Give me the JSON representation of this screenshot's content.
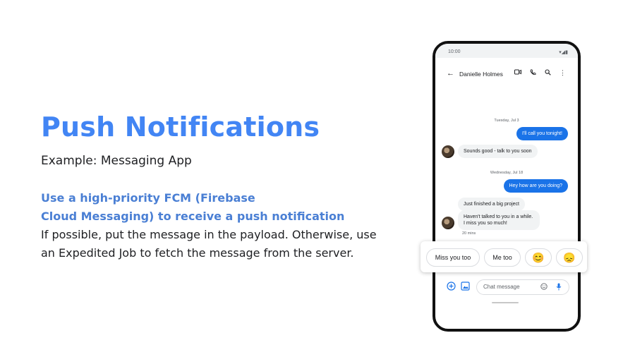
{
  "slide": {
    "title": "Push Notifications",
    "subtitle": "Example: Messaging App",
    "highlight_line_1": "Use a high-priority FCM (Firebase",
    "highlight_line_2": "Cloud Messaging) to receive a push notification",
    "body_line_1": "If possible, put the message in the payload. Otherwise, use",
    "body_line_2": "an Expedited Job to fetch the message from the server."
  },
  "phone": {
    "status_time": "10:00",
    "contact_name": "Danielle Holmes",
    "messages": {
      "date_1": "Tuesday, Jul 3",
      "sent_1": "I'll call you tonight!",
      "received_1": "Sounds good - talk to you soon",
      "date_2": "Wednesday, Jul 18",
      "sent_2": "Hey how are you doing?",
      "received_2": "Just finished a big project",
      "received_3_line_1": "Haven't talked to you in a while.",
      "received_3_line_2": "I miss you so much!",
      "timestamp": "20 mins"
    },
    "suggestions": {
      "chip_1": "Miss you too",
      "chip_2": "Me too",
      "chip_3": "😊",
      "chip_4": "😞"
    },
    "compose": {
      "placeholder": "Chat message"
    }
  },
  "colors": {
    "accent": "#4285f4",
    "sent_bubble": "#1a73e8",
    "received_bubble": "#f1f3f4"
  },
  "icons": [
    "back-arrow-icon",
    "video-icon",
    "phone-icon",
    "search-icon",
    "more-vert-icon",
    "add-icon",
    "gallery-icon",
    "emoji-icon",
    "mic-icon"
  ]
}
